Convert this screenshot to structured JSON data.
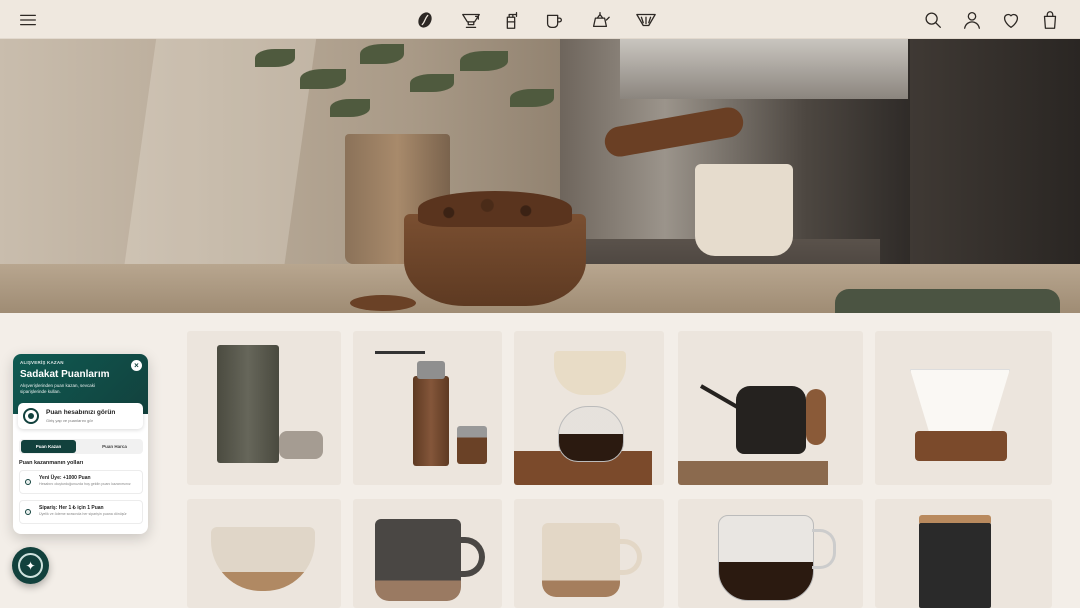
{
  "nav": {
    "left_icons": [
      "menu-icon"
    ],
    "center_icons": [
      "coffee-bean-icon",
      "pour-over-dripper-icon",
      "grinder-icon",
      "mug-icon",
      "kettle-icon",
      "filter-icon"
    ],
    "right_icons": [
      "search-icon",
      "account-icon",
      "wishlist-heart-icon",
      "bag-icon"
    ]
  },
  "loyalty": {
    "eyebrow": "ALIŞVERİŞ KAZAN",
    "title": "Sadakat Puanlarım",
    "subtitle": "Alışverişlerinden puan kazan, sevcaki siparişlerinde kullan.",
    "close_label": "×",
    "account": {
      "title": "Puan hesabınızı görün",
      "subtitle": "Giriş yap ve puanlarını gör"
    },
    "tabs": [
      "Puan Kazan",
      "Puan Harca"
    ],
    "section_title": "Puan kazanmanın yolları",
    "ways": [
      {
        "title": "Yeni Üye: +1000 Puan",
        "desc": "Hesabını oluşturduğunuzda hoş geldin puanı kazanırsınız"
      },
      {
        "title": "Sipariş: Her 1 ₺ için 1 Puan",
        "desc": "Üyelik ve ödeme sırasında her siparişin puana dönüşür"
      }
    ]
  },
  "colors": {
    "brand": "#12413d",
    "nav_bg": "#efe8df",
    "page_bg": "#f3eee8"
  }
}
